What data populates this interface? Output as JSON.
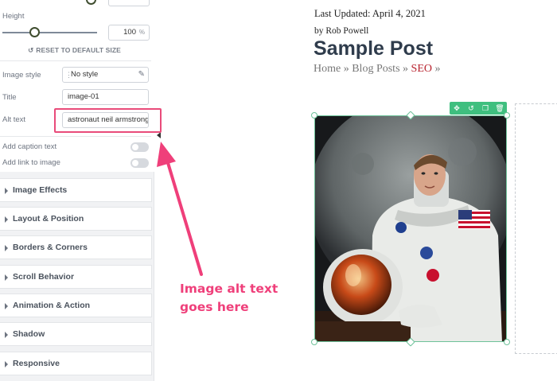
{
  "panel": {
    "height_label": "Height",
    "height_value": "100",
    "height_unit": "%",
    "height_slider_level_percent": 34,
    "reset_label": "RESET TO DEFAULT SIZE",
    "image_style_label": "Image style",
    "image_style_value": "No style",
    "title_label": "Title",
    "title_value": "image-01",
    "alt_text_label": "Alt text",
    "alt_text_value": "astronaut neil armstrong",
    "caption_label": "Add caption text",
    "caption_enabled": false,
    "link_label": "Add link to image",
    "link_enabled": false,
    "sections": [
      "Image Effects",
      "Layout & Position",
      "Borders & Corners",
      "Scroll Behavior",
      "Animation & Action",
      "Shadow",
      "Responsive"
    ]
  },
  "article": {
    "last_updated": "Last Updated: April 4, 2021",
    "byline": "by Rob Powell",
    "title": "Sample Post",
    "breadcrumb": {
      "home": "Home",
      "sep": "»",
      "blog": "Blog Posts",
      "current": "SEO"
    }
  },
  "image": {
    "toolbar_icons": [
      "move-icon",
      "rotate-icon",
      "duplicate-icon",
      "delete-icon"
    ],
    "accent_color": "#3fbf7f"
  },
  "annotation": {
    "line1": "Image alt text",
    "line2": "goes here",
    "color": "#ef3f7a"
  }
}
